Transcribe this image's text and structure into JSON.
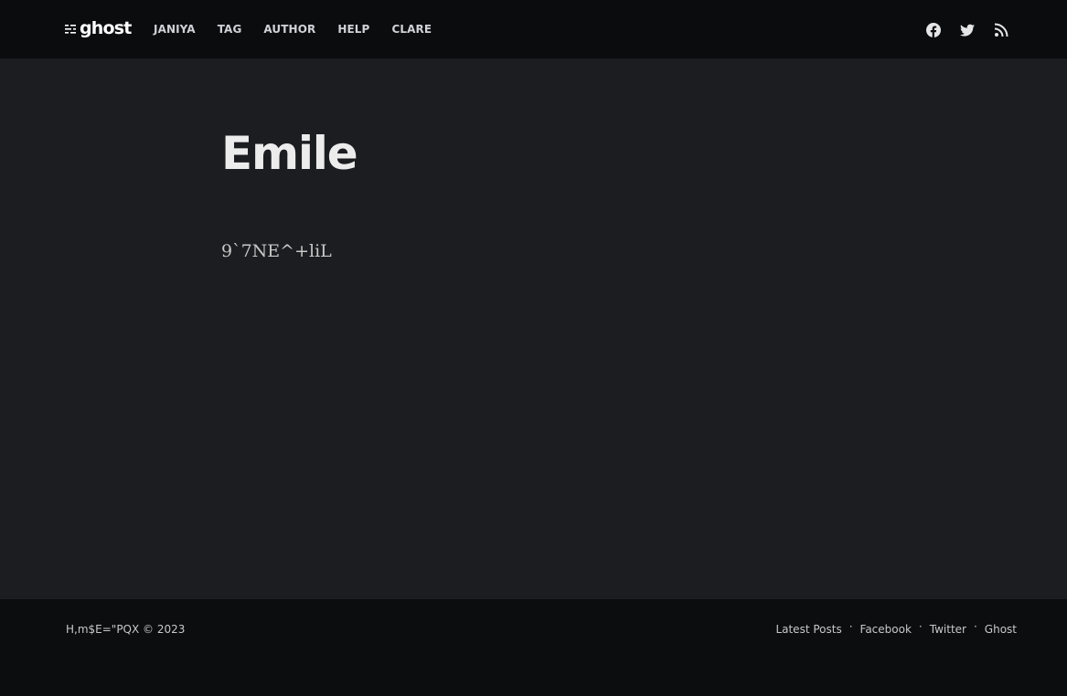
{
  "header": {
    "logo_text": "ghost",
    "nav": [
      {
        "label": "JANIYA"
      },
      {
        "label": "TAG"
      },
      {
        "label": "AUTHOR"
      },
      {
        "label": "HELP"
      },
      {
        "label": "CLARE"
      }
    ],
    "social_icons": [
      "facebook-icon",
      "twitter-icon",
      "rss-icon"
    ]
  },
  "main": {
    "title": "Emile",
    "body": "9`7NE^+liL"
  },
  "footer": {
    "copyright": "H,m$E=\"PQX © 2023",
    "links": [
      {
        "label": "Latest Posts"
      },
      {
        "label": "Facebook"
      },
      {
        "label": "Twitter"
      },
      {
        "label": "Ghost"
      }
    ],
    "separator": "·"
  },
  "colors": {
    "header_bg": "#0b0c0e",
    "main_bg": "#1c1d21",
    "footer_bg": "#0c0d0f",
    "title_text": "#ececec",
    "body_text": "#c8c8c8"
  }
}
